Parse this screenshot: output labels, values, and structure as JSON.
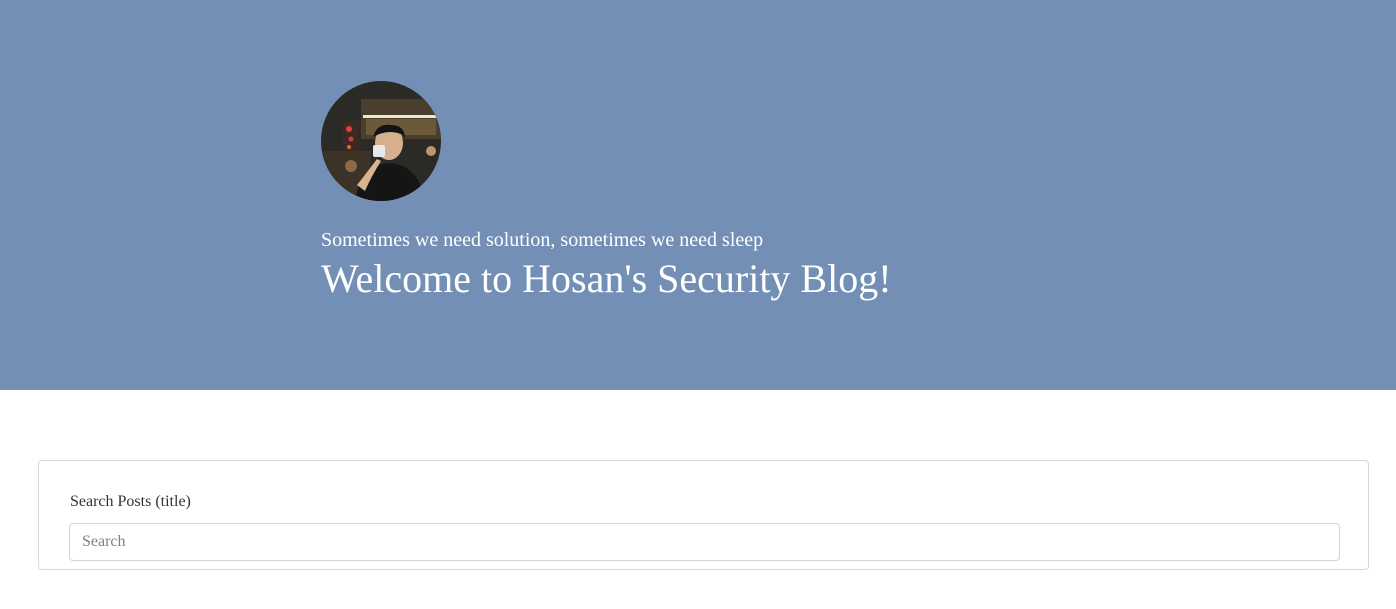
{
  "hero": {
    "background_color": "#738fb5",
    "avatar_alt": "profile photo",
    "tagline": "Sometimes we need solution, sometimes we need sleep",
    "title": "Welcome to Hosan's Security Blog!"
  },
  "search": {
    "label": "Search Posts (title)",
    "placeholder": "Search",
    "value": ""
  }
}
